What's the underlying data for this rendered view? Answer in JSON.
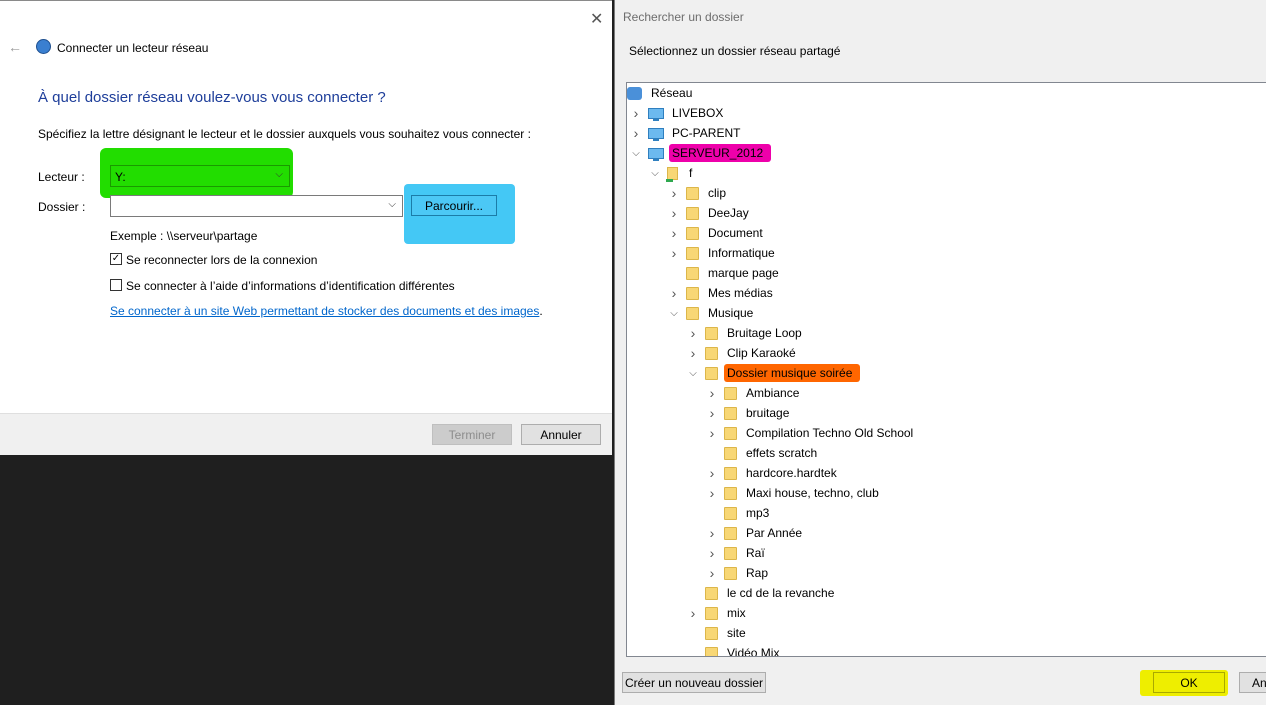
{
  "left_dialog": {
    "title": "Connecter un lecteur réseau",
    "heading": "À quel dossier réseau voulez-vous vous connecter ?",
    "instructions": "Spécifiez la lettre désignant le lecteur et le dossier auxquels vous souhaitez vous connecter :",
    "drive_label": "Lecteur :",
    "drive_value": "Y:",
    "folder_label": "Dossier :",
    "folder_value": "",
    "browse_label": "Parcourir...",
    "example": "Exemple : \\\\serveur\\partage",
    "reconnect_label": "Se reconnecter lors de la connexion",
    "reconnect_checked": true,
    "credentials_label": "Se connecter à l’aide d’informations d’identification différentes",
    "credentials_checked": false,
    "link_text": "Se connecter à un site Web permettant de stocker des documents et des images",
    "link_suffix": ".",
    "finish_label": "Terminer",
    "cancel_label": "Annuler",
    "highlight_colors": {
      "drive": "#22dd00",
      "browse": "#44c8f5"
    }
  },
  "right_dialog": {
    "title": "Rechercher un dossier",
    "instruction": "Sélectionnez un dossier réseau partagé",
    "new_folder_label": "Créer un nouveau dossier",
    "ok_label": "OK",
    "cancel_label": "Ann",
    "highlight_colors": {
      "server": "#ee00aa",
      "selected_folder": "#ff6600",
      "ok": "#eeee00"
    },
    "tree": [
      {
        "label": "Réseau",
        "icon": "network-icon",
        "level": 0,
        "expander": ""
      },
      {
        "label": "LIVEBOX",
        "icon": "computer-icon",
        "level": 1,
        "expander": "collapsed"
      },
      {
        "label": "PC-PARENT",
        "icon": "computer-icon",
        "level": 1,
        "expander": "collapsed"
      },
      {
        "label": "SERVEUR_2012",
        "icon": "computer-icon",
        "level": 1,
        "expander": "expanded",
        "highlight": "server"
      },
      {
        "label": "f",
        "icon": "share-icon",
        "level": 2,
        "expander": "expanded"
      },
      {
        "label": "clip",
        "icon": "folder-icon",
        "level": 3,
        "expander": "collapsed"
      },
      {
        "label": "DeeJay",
        "icon": "folder-icon",
        "level": 3,
        "expander": "collapsed"
      },
      {
        "label": "Document",
        "icon": "folder-icon",
        "level": 3,
        "expander": "collapsed"
      },
      {
        "label": "Informatique",
        "icon": "folder-icon",
        "level": 3,
        "expander": "collapsed"
      },
      {
        "label": "marque page",
        "icon": "folder-icon",
        "level": 3,
        "expander": ""
      },
      {
        "label": "Mes médias",
        "icon": "folder-icon",
        "level": 3,
        "expander": "collapsed"
      },
      {
        "label": "Musique",
        "icon": "folder-icon",
        "level": 3,
        "expander": "expanded"
      },
      {
        "label": "Bruitage Loop",
        "icon": "folder-icon",
        "level": 4,
        "expander": "collapsed"
      },
      {
        "label": "Clip Karaoké",
        "icon": "folder-icon",
        "level": 4,
        "expander": "collapsed"
      },
      {
        "label": "Dossier musique soirée",
        "icon": "folder-icon",
        "level": 4,
        "expander": "expanded",
        "highlight": "selected_folder"
      },
      {
        "label": "Ambiance",
        "icon": "folder-icon",
        "level": 5,
        "expander": "collapsed"
      },
      {
        "label": "bruitage",
        "icon": "folder-icon",
        "level": 5,
        "expander": "collapsed"
      },
      {
        "label": "Compilation Techno Old School",
        "icon": "folder-icon",
        "level": 5,
        "expander": "collapsed"
      },
      {
        "label": "effets scratch",
        "icon": "folder-icon",
        "level": 5,
        "expander": ""
      },
      {
        "label": "hardcore.hardtek",
        "icon": "folder-icon",
        "level": 5,
        "expander": "collapsed"
      },
      {
        "label": "Maxi house, techno, club",
        "icon": "folder-icon",
        "level": 5,
        "expander": "collapsed"
      },
      {
        "label": "mp3",
        "icon": "folder-icon",
        "level": 5,
        "expander": ""
      },
      {
        "label": "Par Année",
        "icon": "folder-icon",
        "level": 5,
        "expander": "collapsed"
      },
      {
        "label": "Raï",
        "icon": "folder-icon",
        "level": 5,
        "expander": "collapsed"
      },
      {
        "label": "Rap",
        "icon": "folder-icon",
        "level": 5,
        "expander": "collapsed"
      },
      {
        "label": "le cd de la revanche",
        "icon": "folder-icon",
        "level": 4,
        "expander": ""
      },
      {
        "label": "mix",
        "icon": "folder-icon",
        "level": 4,
        "expander": "collapsed"
      },
      {
        "label": "site",
        "icon": "folder-icon",
        "level": 4,
        "expander": ""
      },
      {
        "label": "Vidéo Mix",
        "icon": "folder-icon",
        "level": 4,
        "expander": ""
      }
    ]
  }
}
